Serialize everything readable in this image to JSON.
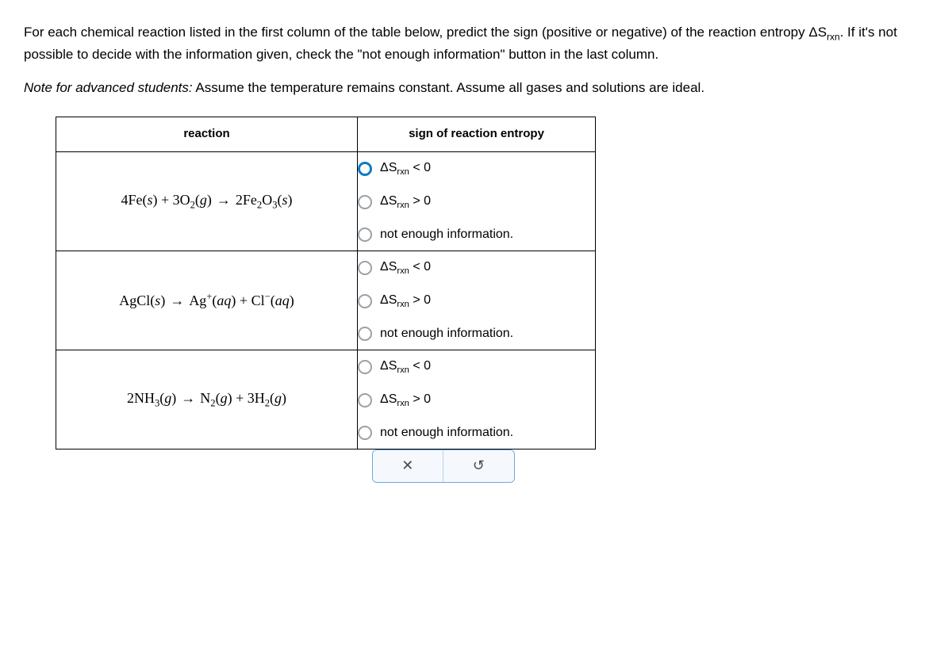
{
  "question": {
    "p1_a": "For each chemical reaction listed in the first column of the table below, predict the sign (positive or negative) of the reaction entropy ",
    "p1_b": ". If it's not possible to decide with the information given, check the \"not enough information\" button in the last column.",
    "note_prefix": "Note for advanced students:",
    "note_rest": " Assume the temperature remains constant. Assume all gases and solutions are ideal."
  },
  "delta_s": "ΔS",
  "rxn": "rxn",
  "headers": {
    "reaction": "reaction",
    "entropy": "sign of reaction entropy"
  },
  "options": {
    "lt": " < 0",
    "gt": " > 0",
    "nei": "not enough information."
  },
  "reactions": {
    "r1": {
      "a_coef": "4",
      "a_el": "Fe",
      "a_phase": "s",
      "plus1": " + ",
      "b_coef": "3",
      "b_el": "O",
      "b_sub": "2",
      "b_phase": "g",
      "arrow": "→",
      "c_coef": "2",
      "c_el": "Fe",
      "c_sub1": "2",
      "c_el2": "O",
      "c_sub2": "3",
      "c_phase": "s"
    },
    "r2": {
      "a_el": "AgCl",
      "a_phase": "s",
      "arrow": "→",
      "b_el": "Ag",
      "b_charge": "+",
      "b_phase": "aq",
      "plus1": " + ",
      "c_el": "Cl",
      "c_charge": "−",
      "c_phase": "aq"
    },
    "r3": {
      "a_coef": "2",
      "a_el": "NH",
      "a_sub": "3",
      "a_phase": "g",
      "arrow": "→",
      "b_el": "N",
      "b_sub": "2",
      "b_phase": "g",
      "plus1": " + ",
      "c_coef": "3",
      "c_el": "H",
      "c_sub": "2",
      "c_phase": "g"
    }
  },
  "actions": {
    "clear": "✕",
    "reset": "↺"
  }
}
